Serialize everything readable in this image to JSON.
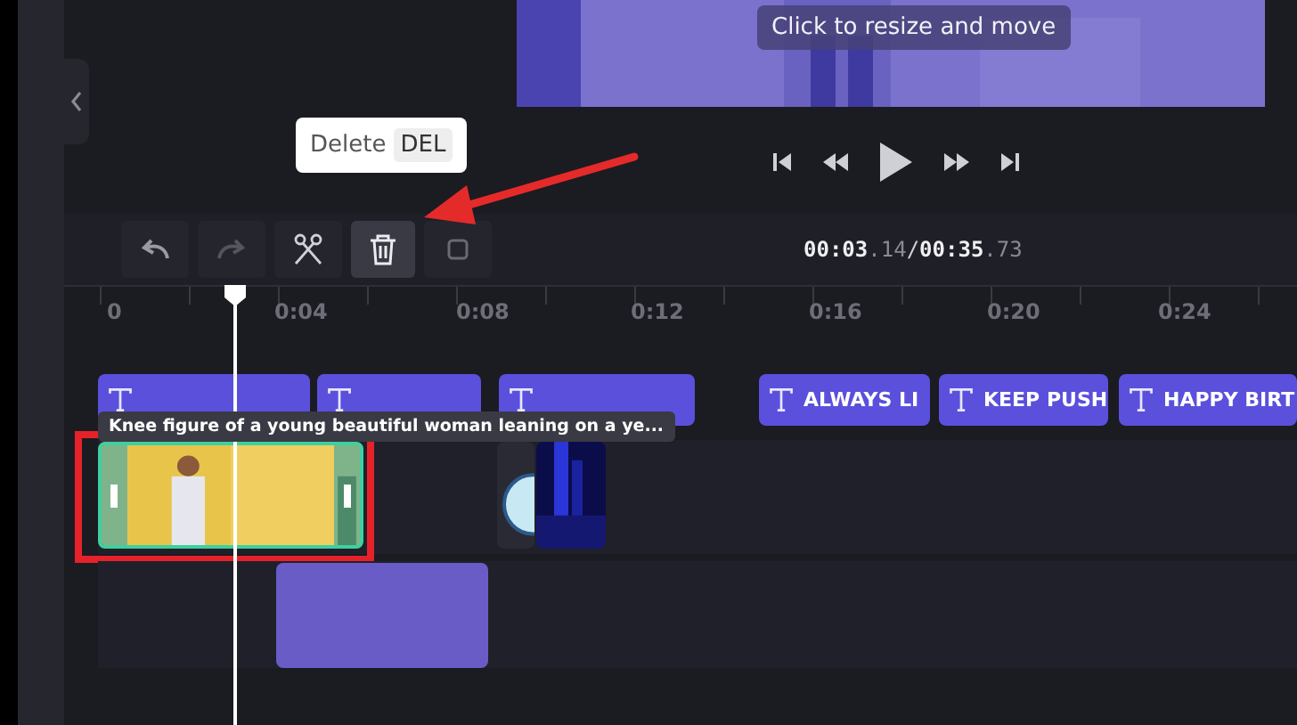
{
  "preview": {
    "hint": "Click to resize and move"
  },
  "playback": [
    {
      "kind": "skip-back"
    },
    {
      "kind": "rewind"
    },
    {
      "kind": "play"
    },
    {
      "kind": "forward"
    },
    {
      "kind": "skip-forward"
    }
  ],
  "toolbar": [
    {
      "kind": "undo",
      "highlighted": false
    },
    {
      "kind": "redo",
      "highlighted": false
    },
    {
      "kind": "split",
      "highlighted": false
    },
    {
      "kind": "delete",
      "highlighted": true
    },
    {
      "kind": "other",
      "highlighted": false
    }
  ],
  "delete_tooltip": {
    "label": "Delete",
    "key": "DEL"
  },
  "time": {
    "current": "00:03",
    "current_fraction": ".14",
    "separator": "/",
    "total": "00:35",
    "total_fraction": ".73"
  },
  "ruler": [
    "0",
    "0:04",
    "0:08",
    "0:12",
    "0:16",
    "0:20",
    "0:24"
  ],
  "text_clips": [
    {
      "kind": "covered"
    },
    {
      "kind": "covered"
    },
    {
      "kind": "covered"
    },
    {
      "kind": "labeled",
      "label": "ALWAYS LI"
    },
    {
      "kind": "labeled",
      "label": "KEEP PUSH"
    },
    {
      "kind": "labeled",
      "label": "HAPPY BIRT"
    }
  ],
  "clip_tooltip": "Knee figure of a young beautiful woman leaning on a ye...",
  "media_clips": [
    {
      "kind": "picture",
      "selected": true
    },
    {
      "kind": "sticker",
      "selected": false
    },
    {
      "kind": "picture",
      "selected": false
    }
  ]
}
